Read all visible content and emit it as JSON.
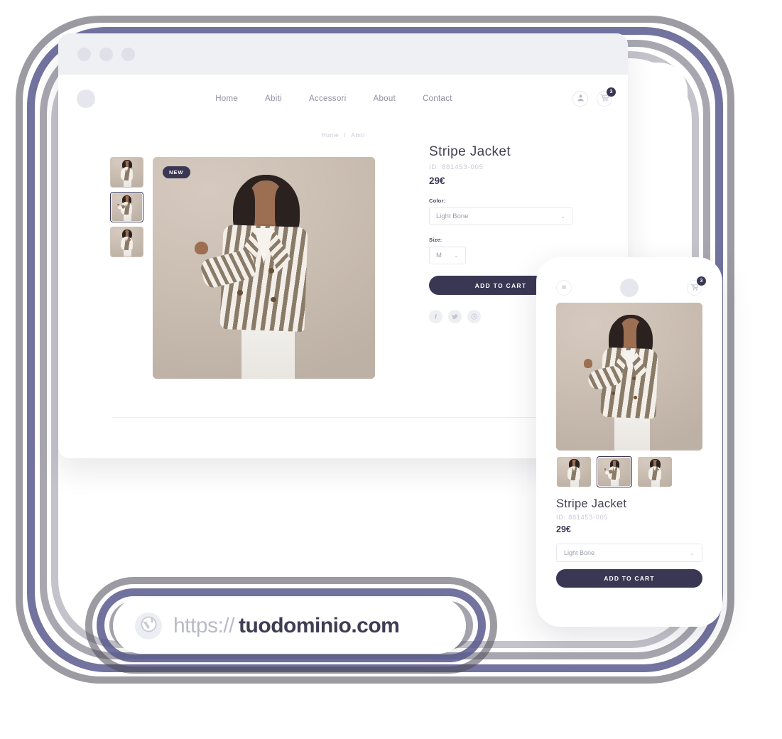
{
  "rings": {
    "accent": "#5b5b8f",
    "dark": "#4a4856",
    "mid": "#605f70",
    "light": "#7c7b8b"
  },
  "browser": {
    "traffic_lights": [
      "dot-1",
      "dot-2",
      "dot-3"
    ],
    "header": {
      "logo": "logo-placeholder",
      "nav": [
        {
          "label": "Home"
        },
        {
          "label": "Abiti"
        },
        {
          "label": "Accessori"
        },
        {
          "label": "About"
        },
        {
          "label": "Contact"
        }
      ],
      "account_icon": "user-icon",
      "cart_icon": "cart-icon",
      "cart_count": "3"
    },
    "breadcrumb": {
      "home": "Home",
      "separator": "/",
      "current": "Abiti"
    },
    "gallery": {
      "badge": "NEW",
      "thumbnails": [
        {
          "name": "thumbnail-1",
          "selected": false
        },
        {
          "name": "thumbnail-2",
          "selected": true
        },
        {
          "name": "thumbnail-3",
          "selected": false
        }
      ]
    },
    "product": {
      "title": "Stripe Jacket",
      "id": "ID: 881453-005",
      "price": "29€",
      "color_label": "Color:",
      "color_value": "Light Bone",
      "size_label": "Size:",
      "size_value": "M",
      "add_to_cart": "ADD TO CART",
      "socials": [
        {
          "name": "facebook-icon"
        },
        {
          "name": "twitter-icon"
        },
        {
          "name": "pinterest-icon"
        }
      ]
    }
  },
  "phone": {
    "header": {
      "menu_icon": "hamburger-menu-icon",
      "logo": "logo-placeholder",
      "cart_icon": "cart-icon",
      "cart_count": "3"
    },
    "thumbnails": [
      {
        "name": "thumbnail-1",
        "selected": false
      },
      {
        "name": "thumbnail-2",
        "selected": true
      },
      {
        "name": "thumbnail-3",
        "selected": false
      }
    ],
    "product": {
      "title": "Stripe Jacket",
      "id": "ID: 881453-005",
      "price": "29€",
      "color_value": "Light Bone",
      "add_to_cart": "ADD TO CART"
    }
  },
  "url_pill": {
    "globe_icon": "globe-icon",
    "protocol": "https://",
    "domain": "tuodominio.com"
  }
}
